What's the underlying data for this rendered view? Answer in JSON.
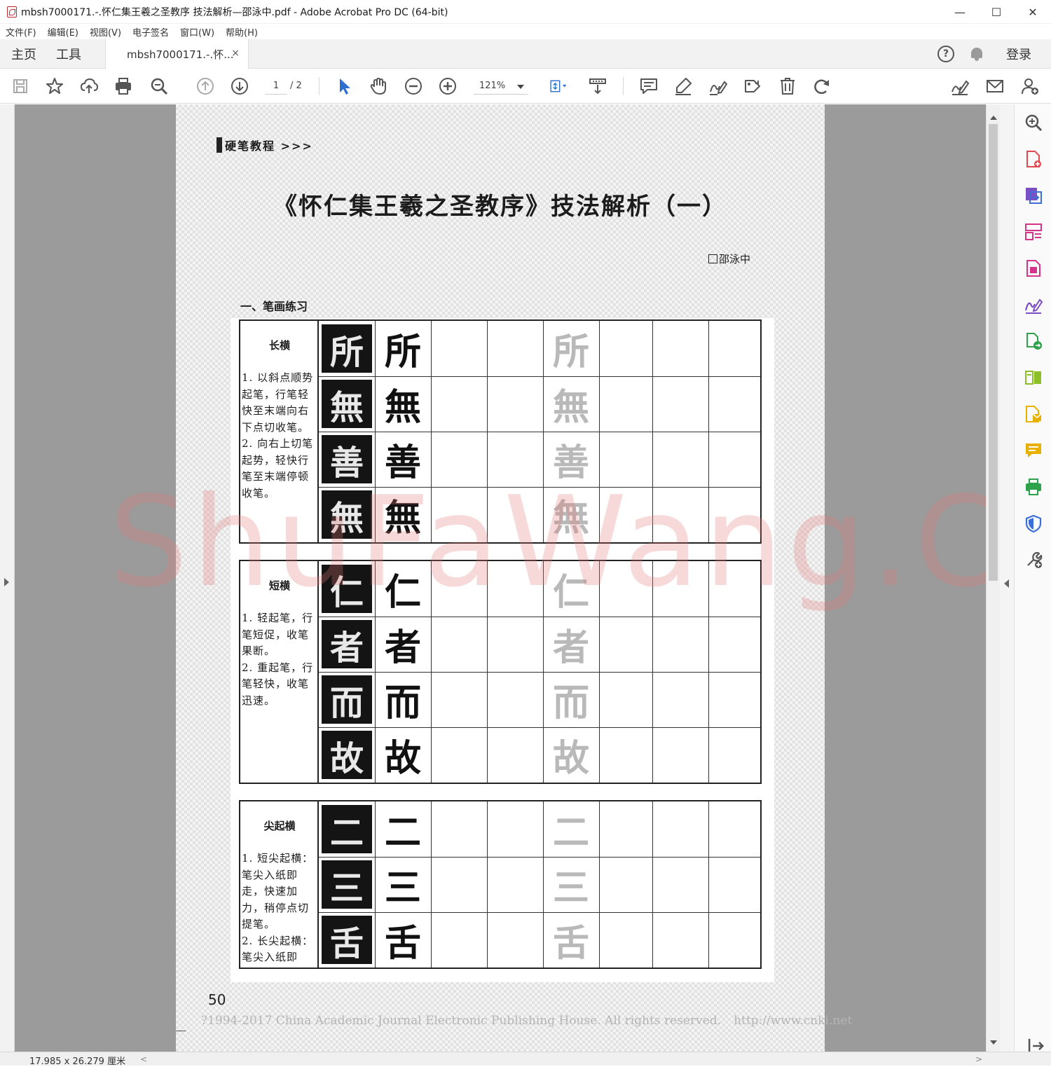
{
  "window": {
    "title": "mbsh7000171.-.怀仁集王羲之圣教序 技法解析—邵泳中.pdf - Adobe Acrobat Pro DC (64-bit)",
    "minimize": "—",
    "maximize": "☐",
    "close": "✕"
  },
  "menu": [
    "文件(F)",
    "编辑(E)",
    "视图(V)",
    "电子签名",
    "窗口(W)",
    "帮助(H)"
  ],
  "tabs": {
    "home": "主页",
    "tools": "工具",
    "document": "mbsh7000171.-.怀...",
    "close": "×",
    "help": "?",
    "login": "登录"
  },
  "toolbar": {
    "page_current": "1",
    "page_total": "/ 2",
    "zoom": "121%"
  },
  "document": {
    "section_tag": "硬笔教程 >>>",
    "title": "《怀仁集王羲之圣教序》技法解析（一）",
    "author": "邵泳中",
    "subheading": "一、笔画练习",
    "page_number": "50",
    "copyright": "?1994-2017 China Academic Journal Electronic Publishing House. All rights reserved.",
    "copyright_url": "http://www.cnki.net",
    "tables": [
      {
        "title": "长横",
        "description": "1. 以斜点顺势起笔，行笔轻快至末端向右下点切收笔。\n2. 向右上切笔起势，轻快行笔至末端停顿收笔。",
        "chars": [
          "所",
          "無",
          "善",
          "無"
        ]
      },
      {
        "title": "短横",
        "description": "1. 轻起笔，行笔短促，收笔果断。\n2. 重起笔，行笔轻快，收笔迅速。",
        "chars": [
          "仁",
          "者",
          "而",
          "故"
        ]
      },
      {
        "title": "尖起横",
        "description": "1. 短尖起横：笔尖入纸即走，快速加力，稍停点切提笔。\n2. 长尖起横：笔尖入纸即",
        "chars": [
          "二",
          "三",
          "舌"
        ]
      }
    ]
  },
  "watermark": "ShuFaWang.CN",
  "status": {
    "page_size": "17.985 x 26.279 厘米",
    "scroll_left": "<",
    "scroll_right": ">"
  },
  "colors": {
    "doc_background": "#9b9b9b",
    "watermark": "#e67878",
    "accent_blue": "#2d6fd1",
    "tool_red": "#e34850",
    "tool_purple": "#7d4fc4",
    "tool_pink": "#d6338c",
    "tool_green": "#2ea24a",
    "tool_yellow": "#e8b100",
    "tool_blue": "#3c6fd8"
  }
}
